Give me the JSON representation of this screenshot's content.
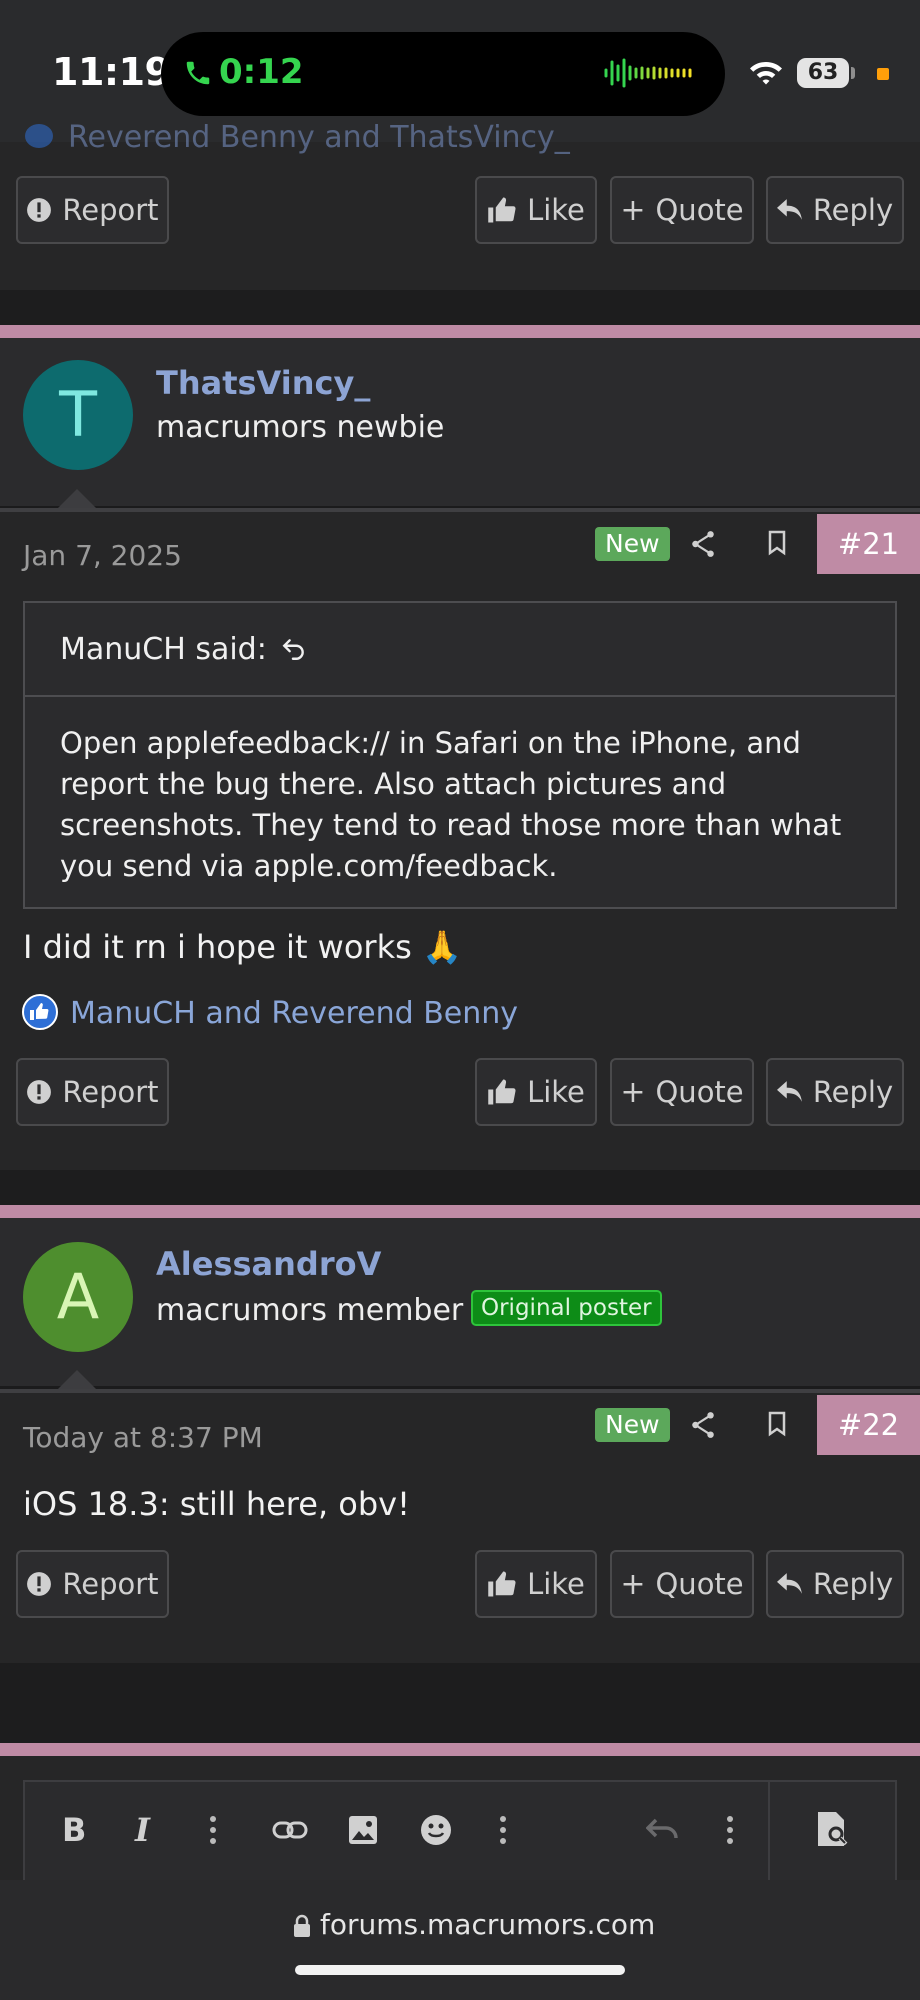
{
  "status_bar": {
    "time": "11:19",
    "call_duration": "0:12",
    "battery": "63",
    "icons": [
      "phone-icon",
      "audio-wave-icon",
      "wifi-icon",
      "battery-icon",
      "privacy-indicator"
    ]
  },
  "colors": {
    "accent_pink": "#bf8ba5",
    "username_blue": "#8da4d4",
    "new_badge": "#5ca85b",
    "op_badge": "#0d8c17",
    "call_green": "#35d54f"
  },
  "top_post": {
    "reactions_partial": "Reverend Benny and ThatsVincy_",
    "actions": {
      "report": "Report",
      "like": "Like",
      "quote": "Quote",
      "reply": "Reply"
    }
  },
  "posts": [
    {
      "avatar_letter": "T",
      "avatar_color": "#0d6b6e",
      "username": "ThatsVincy_",
      "user_title": "macrumors newbie",
      "date": "Jan 7, 2025",
      "new_label": "New",
      "post_number": "#21",
      "quote": {
        "author": "ManuCH said:",
        "text": "Open applefeedback:// in Safari on the iPhone, and report the bug there. Also attach pictures and screenshots. They tend to read those more than what you send via apple.com/feedback."
      },
      "body": "I did it rn i hope it works 🙏",
      "reactions": "ManuCH and Reverend Benny",
      "actions": {
        "report": "Report",
        "like": "Like",
        "quote": "Quote",
        "reply": "Reply"
      }
    },
    {
      "avatar_letter": "A",
      "avatar_color": "#4e8e2e",
      "username": "AlessandroV",
      "user_title": "macrumors member",
      "badge": "Original poster",
      "date": "Today at 8:37 PM",
      "new_label": "New",
      "post_number": "#22",
      "body": "iOS 18.3: still here, obv!",
      "actions": {
        "report": "Report",
        "like": "Like",
        "quote": "Quote",
        "reply": "Reply"
      }
    }
  ],
  "editor_toolbar": [
    "bold-icon",
    "italic-icon",
    "more-options-icon",
    "link-icon",
    "image-icon",
    "emoji-icon",
    "more-options-icon",
    "undo-icon",
    "more-options-icon",
    "preview-icon"
  ],
  "browser": {
    "url": "forums.macrumors.com"
  }
}
